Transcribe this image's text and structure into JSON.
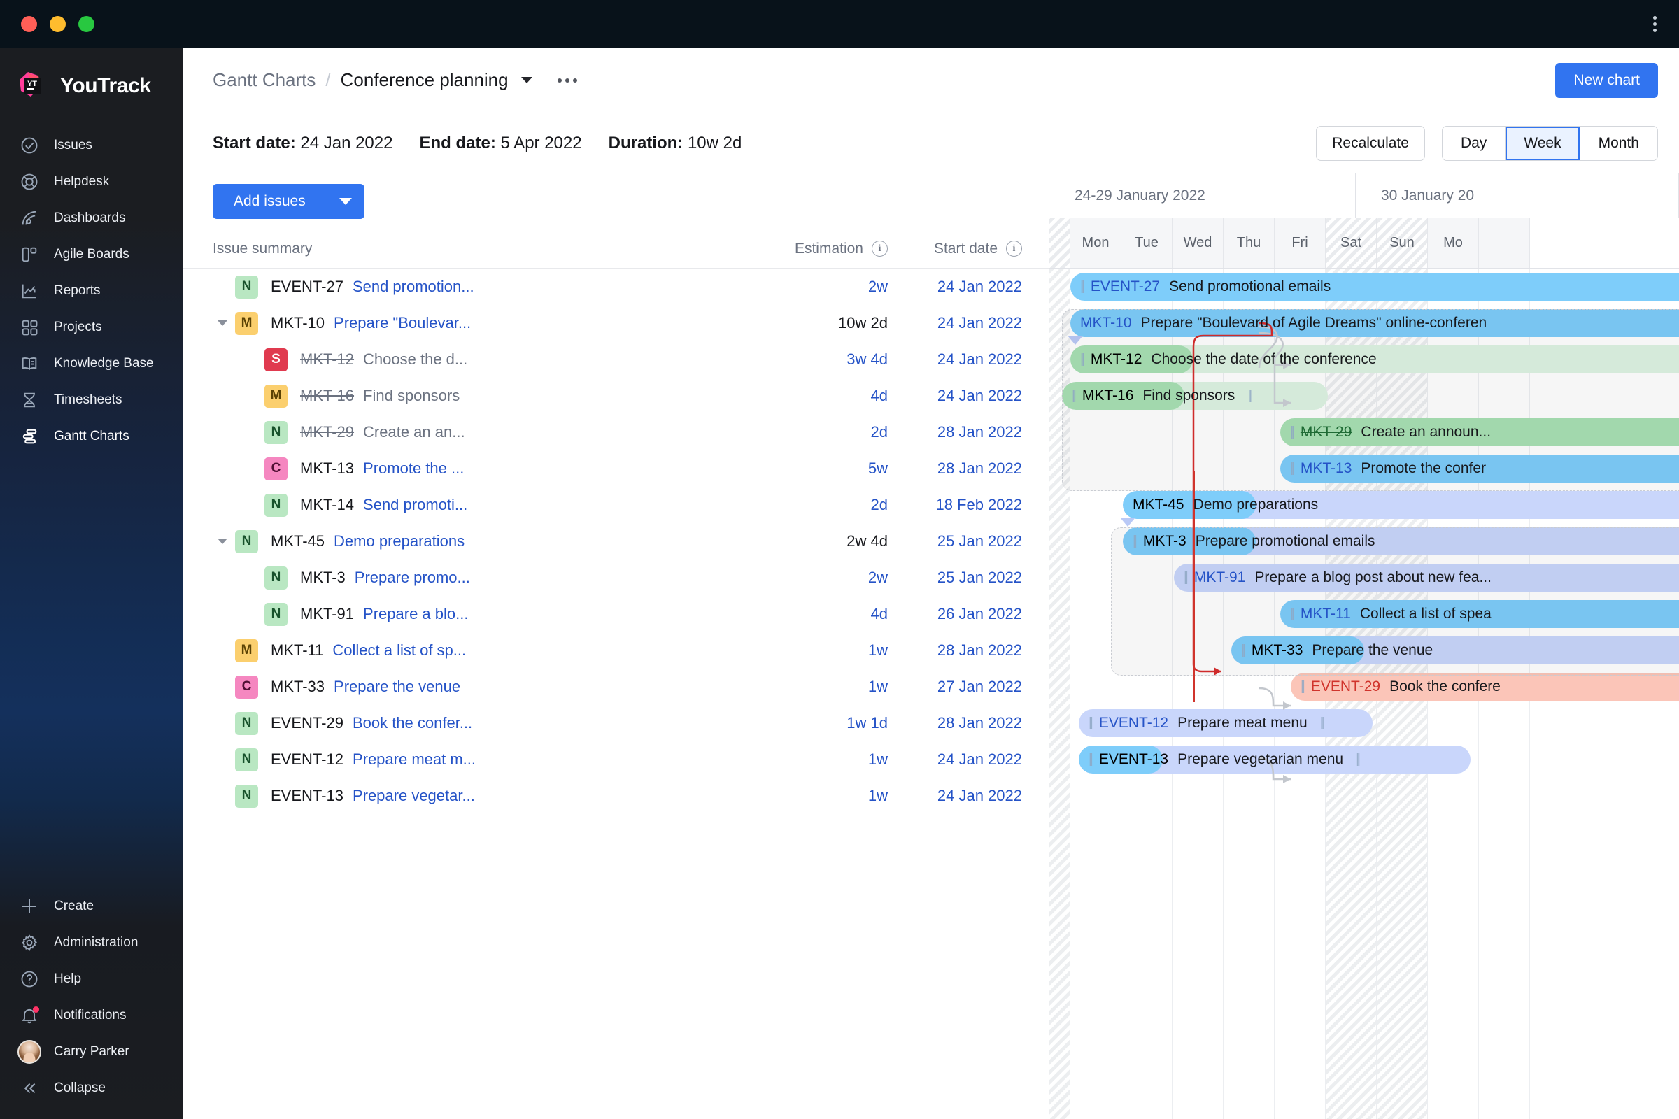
{
  "window": {
    "traffic": [
      "close",
      "minimize",
      "maximize"
    ],
    "menu_icon": "kebab-menu-icon"
  },
  "brand": {
    "name": "YouTrack",
    "logo": "youtrack-logo"
  },
  "sidebar": {
    "items": [
      {
        "label": "Issues",
        "icon": "check-circle-icon",
        "active": false
      },
      {
        "label": "Helpdesk",
        "icon": "lifebuoy-icon",
        "active": false
      },
      {
        "label": "Dashboards",
        "icon": "dashboard-icon",
        "active": false
      },
      {
        "label": "Agile Boards",
        "icon": "agile-board-icon",
        "active": false
      },
      {
        "label": "Reports",
        "icon": "chart-line-icon",
        "active": false
      },
      {
        "label": "Projects",
        "icon": "grid-icon",
        "active": false
      },
      {
        "label": "Knowledge Base",
        "icon": "book-icon",
        "active": false
      },
      {
        "label": "Timesheets",
        "icon": "hourglass-icon",
        "active": false
      },
      {
        "label": "Gantt Charts",
        "icon": "gantt-icon",
        "active": true
      }
    ],
    "bottom": [
      {
        "label": "Create",
        "icon": "plus-icon"
      },
      {
        "label": "Administration",
        "icon": "gear-icon"
      },
      {
        "label": "Help",
        "icon": "question-circle-icon"
      },
      {
        "label": "Notifications",
        "icon": "bell-icon",
        "badge": true
      },
      {
        "label": "Carry Parker",
        "icon": "avatar"
      },
      {
        "label": "Collapse",
        "icon": "chevrons-left-icon"
      }
    ]
  },
  "header": {
    "breadcrumb_root": "Gantt Charts",
    "breadcrumb_sep": "/",
    "breadcrumb_current": "Conference planning",
    "chart_menu_icon": "chevron-down-icon",
    "more_icon": "more-horizontal-icon",
    "new_chart_label": "New chart",
    "accent_color": "#3174f0"
  },
  "meta": {
    "start_date_label": "Start date:",
    "start_date_value": "24 Jan 2022",
    "end_date_label": "End date:",
    "end_date_value": "5 Apr 2022",
    "duration_label": "Duration:",
    "duration_value": "10w 2d",
    "recalculate_label": "Recalculate",
    "scale_options": [
      "Day",
      "Week",
      "Month"
    ],
    "scale_selected": "Week"
  },
  "table": {
    "add_issues_label": "Add issues",
    "add_issues_caret": "chevron-down-icon",
    "columns": [
      {
        "label": "Issue summary",
        "info": false
      },
      {
        "label": "Estimation",
        "info": true
      },
      {
        "label": "Start date",
        "info": true
      }
    ],
    "rows": [
      {
        "twisty": "",
        "depth": 0,
        "type": "n",
        "id": "EVENT-27",
        "summary": "Send promotion...",
        "done": false,
        "estimation": "2w",
        "est_link": true,
        "start": "24 Jan 2022"
      },
      {
        "twisty": "expanded",
        "depth": 0,
        "type": "m",
        "id": "MKT-10",
        "summary": "Prepare \"Boulevar...",
        "done": false,
        "estimation": "10w 2d",
        "est_link": false,
        "start": "24 Jan 2022"
      },
      {
        "twisty": "",
        "depth": 1,
        "type": "s",
        "id": "MKT-12",
        "summary": "Choose the d...",
        "done": true,
        "estimation": "3w 4d",
        "est_link": true,
        "start": "24 Jan 2022"
      },
      {
        "twisty": "",
        "depth": 1,
        "type": "m",
        "id": "MKT-16",
        "summary": "Find sponsors",
        "done": true,
        "estimation": "4d",
        "est_link": true,
        "start": "24 Jan 2022"
      },
      {
        "twisty": "",
        "depth": 1,
        "type": "n",
        "id": "MKT-29",
        "summary": "Create an an...",
        "done": true,
        "estimation": "2d",
        "est_link": true,
        "start": "28 Jan 2022"
      },
      {
        "twisty": "",
        "depth": 1,
        "type": "c",
        "id": "MKT-13",
        "summary": "Promote the ...",
        "done": false,
        "estimation": "5w",
        "est_link": true,
        "start": "28 Jan 2022"
      },
      {
        "twisty": "",
        "depth": 1,
        "type": "n",
        "id": "MKT-14",
        "summary": "Send promoti...",
        "done": false,
        "estimation": "2d",
        "est_link": true,
        "start": "18 Feb 2022"
      },
      {
        "twisty": "expanded",
        "depth": 0,
        "type": "n",
        "id": "MKT-45",
        "summary": "Demo preparations",
        "done": false,
        "estimation": "2w 4d",
        "est_link": false,
        "start": "25 Jan 2022"
      },
      {
        "twisty": "",
        "depth": 1,
        "type": "n",
        "id": "MKT-3",
        "summary": "Prepare promo...",
        "done": false,
        "estimation": "2w",
        "est_link": true,
        "start": "25 Jan 2022"
      },
      {
        "twisty": "",
        "depth": 1,
        "type": "n",
        "id": "MKT-91",
        "summary": "Prepare a blo...",
        "done": false,
        "estimation": "4d",
        "est_link": true,
        "start": "26 Jan 2022"
      },
      {
        "twisty": "",
        "depth": 0,
        "type": "m",
        "id": "MKT-11",
        "summary": "Collect a list of sp...",
        "done": false,
        "estimation": "1w",
        "est_link": true,
        "start": "28 Jan 2022"
      },
      {
        "twisty": "",
        "depth": 0,
        "type": "c",
        "id": "MKT-33",
        "summary": "Prepare the venue",
        "done": false,
        "estimation": "1w",
        "est_link": true,
        "start": "27 Jan 2022"
      },
      {
        "twisty": "",
        "depth": 0,
        "type": "n",
        "id": "EVENT-29",
        "summary": "Book the confer...",
        "done": false,
        "estimation": "1w 1d",
        "est_link": true,
        "start": "28 Jan 2022"
      },
      {
        "twisty": "",
        "depth": 0,
        "type": "n",
        "id": "EVENT-12",
        "summary": "Prepare meat m...",
        "done": false,
        "estimation": "1w",
        "est_link": true,
        "start": "24 Jan 2022"
      },
      {
        "twisty": "",
        "depth": 0,
        "type": "n",
        "id": "EVENT-13",
        "summary": "Prepare vegetar...",
        "done": false,
        "estimation": "1w",
        "est_link": true,
        "start": "24 Jan 2022"
      }
    ]
  },
  "gantt": {
    "months": [
      "24-29 January 2022",
      "30 January 20"
    ],
    "days": [
      "Mon",
      "Tue",
      "Wed",
      "Thu",
      "Fri",
      "Sat",
      "Sun",
      "Mo"
    ],
    "weekend_days": [
      "Sat",
      "Sun"
    ],
    "bars": [
      {
        "id": "EVENT-27",
        "text": "Send promotional emails",
        "style": "blue",
        "grip": true,
        "endgrip": false
      },
      {
        "id": "MKT-10",
        "text": "Prepare \"Boulevard of Agile Dreams\" online-conferen",
        "style": "blue",
        "grip": false,
        "endgrip": false
      },
      {
        "id": "MKT-12",
        "text": "Choose the date of the conference",
        "style": "tail-green",
        "grip": true,
        "endgrip": false
      },
      {
        "id": "MKT-16",
        "text": "Find sponsors",
        "style": "tail-green",
        "grip": true,
        "endgrip": true
      },
      {
        "id": "MKT-29",
        "text": "Create an announ...",
        "style": "green",
        "grip": true,
        "endgrip": false
      },
      {
        "id": "MKT-13",
        "text": "Promote the confer",
        "style": "blue",
        "grip": true,
        "endgrip": false
      },
      {
        "id": "MKT-45",
        "text": "Demo preparations",
        "style": "tail-blue",
        "grip": false,
        "endgrip": false
      },
      {
        "id": "MKT-3",
        "text": "Prepare promotional emails",
        "style": "tail-blue",
        "grip": true,
        "endgrip": false
      },
      {
        "id": "MKT-91",
        "text": "Prepare a blog post about new fea...",
        "style": "bluepale",
        "grip": true,
        "endgrip": false
      },
      {
        "id": "MKT-11",
        "text": "Collect a list of spea",
        "style": "blue",
        "grip": true,
        "endgrip": false
      },
      {
        "id": "MKT-33",
        "text": "Prepare the venue",
        "style": "tail-blue",
        "grip": true,
        "endgrip": false
      },
      {
        "id": "EVENT-29",
        "text": "Book the confere",
        "style": "red",
        "grip": true,
        "endgrip": false
      },
      {
        "id": "EVENT-12",
        "text": "Prepare meat menu",
        "style": "bluepale",
        "grip": true,
        "endgrip": true
      },
      {
        "id": "EVENT-13",
        "text": "Prepare vegetarian menu",
        "style": "tail-blue",
        "grip": true,
        "endgrip": true
      }
    ]
  }
}
